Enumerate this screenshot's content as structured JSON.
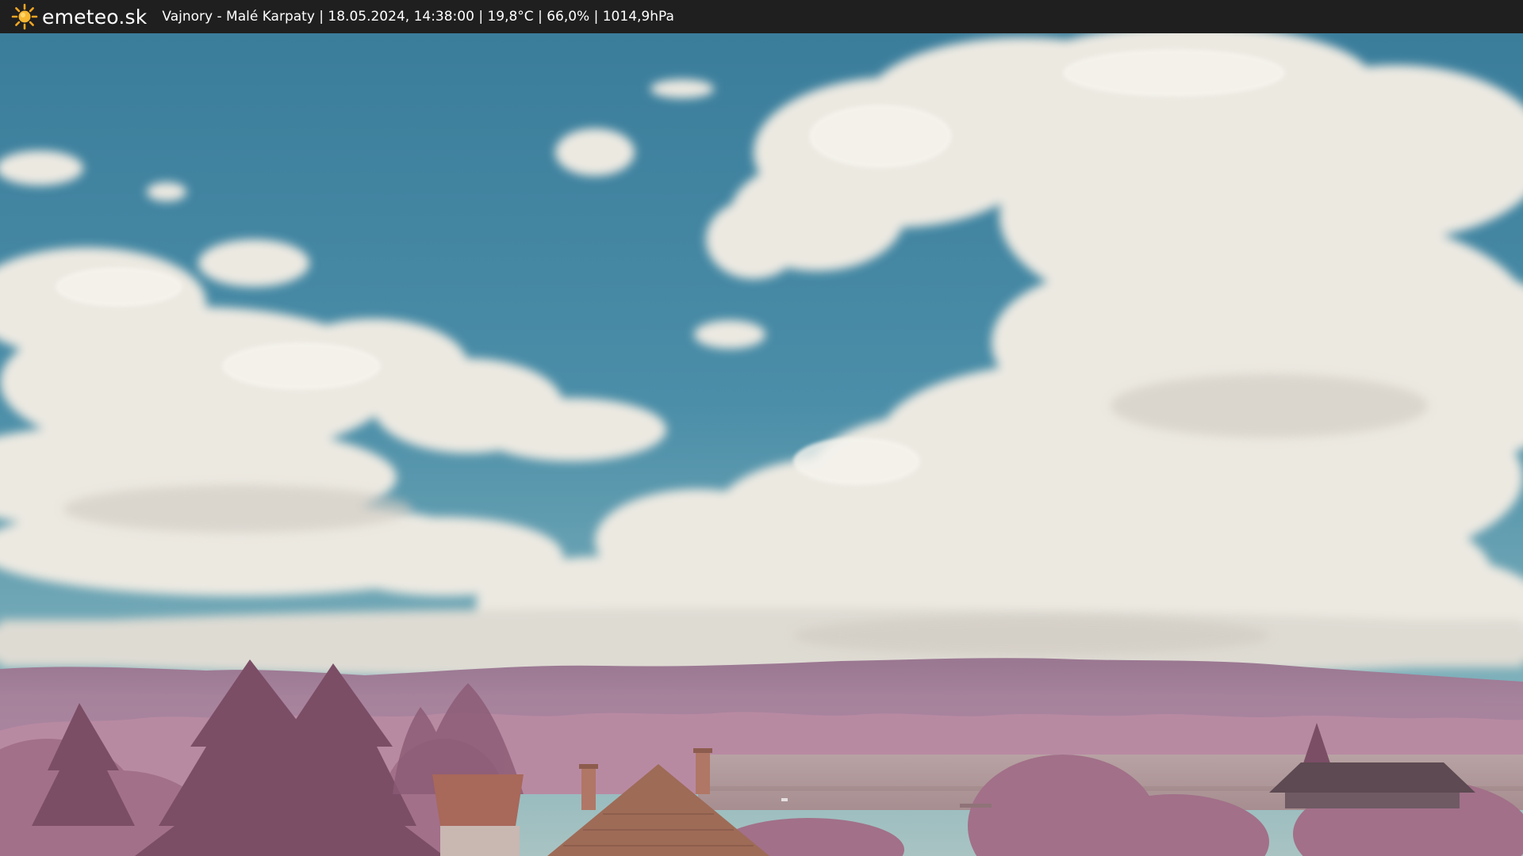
{
  "header": {
    "logo_icon": "sun-icon",
    "brand": "emeteo.sk",
    "caption": "Vajnory - Malé Karpaty | 18.05.2024, 14:38:00 | 19,8°C | 66,0% | 1014,9hPa"
  },
  "colors": {
    "bar": "#1f1f1f",
    "sun": "#f5a623",
    "sky_top": "#3c7f9c",
    "sky_bottom": "#86b4bc",
    "cloud": "#eeebe3",
    "hills": "#9c7690",
    "vegetation": "#b07f98",
    "roof": "#a36a52"
  }
}
